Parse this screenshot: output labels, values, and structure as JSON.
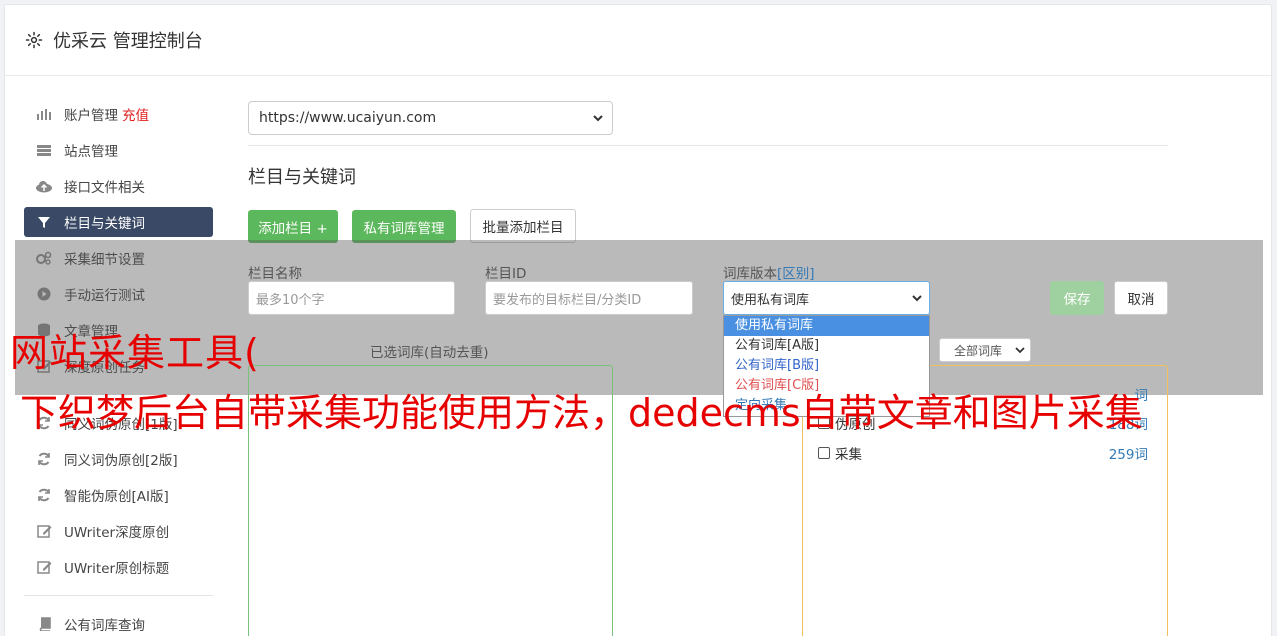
{
  "header": {
    "title": "优采云 管理控制台",
    "icon": "gear-icon"
  },
  "sidebar": {
    "items": [
      {
        "label": "账户管理",
        "extra": "充值",
        "icon": "bar-chart-icon"
      },
      {
        "label": "站点管理",
        "icon": "server-icon"
      },
      {
        "label": "接口文件相关",
        "icon": "cloud-upload-icon"
      },
      {
        "label": "栏目与关键词",
        "icon": "filter-icon",
        "active": true
      },
      {
        "label": "采集细节设置",
        "icon": "gears-icon"
      },
      {
        "label": "手动运行测试",
        "icon": "play-circle-icon"
      },
      {
        "label": "文章管理",
        "icon": "database-icon"
      },
      {
        "label": "深度原创任务",
        "icon": "edit-icon"
      },
      {
        "label": "同义词伪原创[1版]",
        "icon": "refresh-icon"
      },
      {
        "label": "同义词伪原创[2版]",
        "icon": "refresh-icon"
      },
      {
        "label": "智能伪原创[AI版]",
        "icon": "refresh-icon"
      },
      {
        "label": "UWriter深度原创",
        "icon": "edit-icon"
      },
      {
        "label": "UWriter原创标题",
        "icon": "edit-icon"
      },
      {
        "label": "公有词库查询",
        "icon": "book-icon"
      }
    ]
  },
  "main": {
    "site_select_value": "https://www.ucaiyun.com",
    "section_title": "栏目与关键词",
    "buttons": {
      "add_column": "添加栏目 +",
      "private_lib": "私有词库管理",
      "batch_add": "批量添加栏目"
    },
    "form": {
      "name_label": "栏目名称",
      "name_placeholder": "最多10个字",
      "id_label": "栏目ID",
      "id_placeholder": "要发布的目标栏目/分类ID",
      "version_label": "词库版本",
      "version_link": "[区别]",
      "version_value": "使用私有词库",
      "save": "保存",
      "cancel": "取消"
    },
    "dropdown_options": [
      "使用私有词库",
      "公有词库[A版]",
      "公有词库[B版]",
      "公有词库[C版]",
      "定向采集"
    ],
    "selected_label": "已选词库(自动去重)",
    "lib_filter": "全部词库",
    "libraries": [
      {
        "name": "",
        "count": "词"
      },
      {
        "name": "伪原创",
        "count": "188词"
      },
      {
        "name": "采集",
        "count": "259词"
      }
    ]
  },
  "watermark": {
    "line1": "网站采集工具(",
    "line2": "下织梦后台自带采集功能使用方法，dedecms自带文章和图片采集"
  }
}
